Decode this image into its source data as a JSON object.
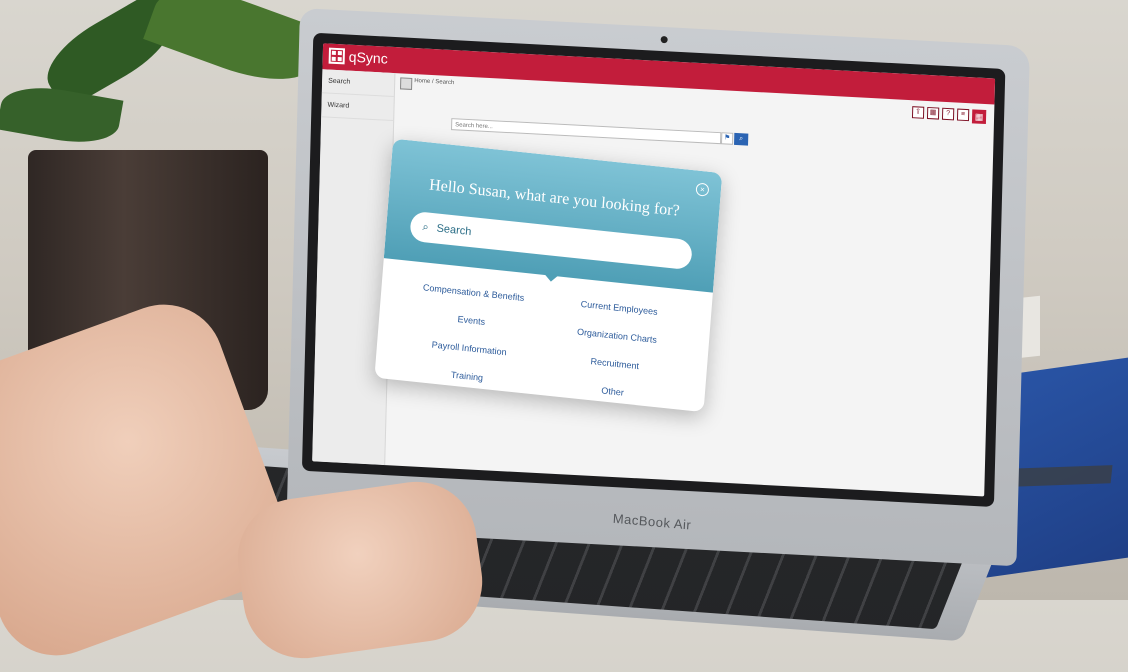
{
  "app": {
    "name": "qSync"
  },
  "sidebar": {
    "items": [
      {
        "label": "Search"
      },
      {
        "label": "Wizard"
      }
    ]
  },
  "breadcrumb": "Home / Search",
  "search_bar": {
    "placeholder": "Search here..."
  },
  "modal": {
    "title": "Hello Susan, what are you looking for?",
    "search_placeholder": "Search",
    "categories_left": [
      "Compensation & Benefits",
      "Events",
      "Payroll Information",
      "Training"
    ],
    "categories_right": [
      "Current Employees",
      "Organization Charts",
      "Recruitment",
      "Other"
    ]
  },
  "device": {
    "brand": "MacBook Air"
  },
  "colors": {
    "topbar": "#c21d3b",
    "modal_header": "#5aa8bd",
    "accent": "#2b64b3"
  }
}
